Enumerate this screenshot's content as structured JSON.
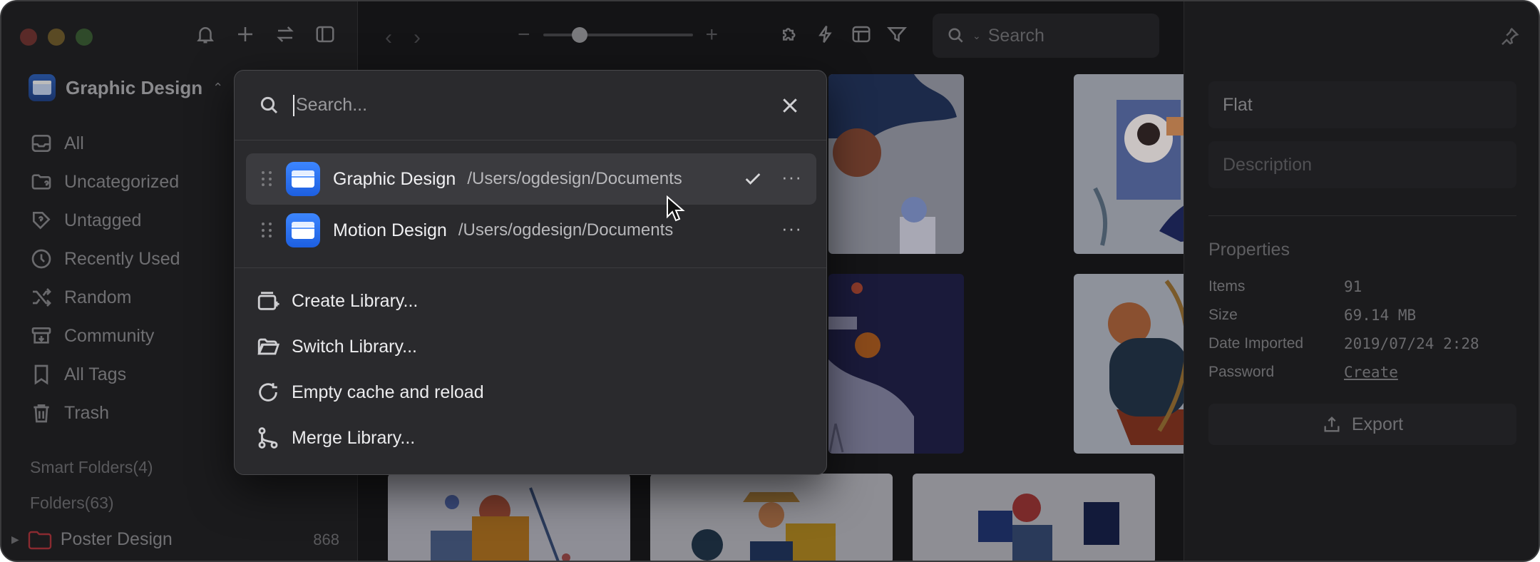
{
  "sidebar": {
    "library_name": "Graphic Design",
    "nav": [
      {
        "label": "All",
        "icon": "inbox-icon"
      },
      {
        "label": "Uncategorized",
        "icon": "folder-question-icon"
      },
      {
        "label": "Untagged",
        "icon": "tag-question-icon"
      },
      {
        "label": "Recently Used",
        "icon": "clock-icon"
      },
      {
        "label": "Random",
        "icon": "shuffle-icon"
      },
      {
        "label": "Community",
        "icon": "archive-icon"
      },
      {
        "label": "All Tags",
        "icon": "bookmark-icon"
      },
      {
        "label": "Trash",
        "icon": "trash-icon"
      }
    ],
    "smart_folders_label": "Smart Folders(4)",
    "folders_label": "Folders(63)",
    "poster_folder": {
      "label": "Poster Design",
      "count": "868"
    }
  },
  "toolbar": {
    "search_placeholder": "Search"
  },
  "inspector": {
    "name_value": "Flat",
    "description_placeholder": "Description",
    "properties_title": "Properties",
    "properties": [
      {
        "key": "Items",
        "value": "91"
      },
      {
        "key": "Size",
        "value": "69.14 MB"
      },
      {
        "key": "Date Imported",
        "value": "2019/07/24 2:28"
      },
      {
        "key": "Password",
        "value": "Create"
      }
    ],
    "export_label": "Export"
  },
  "popover": {
    "search_placeholder": "Search...",
    "libraries": [
      {
        "name": "Graphic Design",
        "path": "/Users/ogdesign/Documents",
        "active": true
      },
      {
        "name": "Motion Design",
        "path": "/Users/ogdesign/Documents",
        "active": false
      }
    ],
    "more_label": "···",
    "actions": [
      {
        "label": "Create Library...",
        "icon": "create-library-icon"
      },
      {
        "label": "Switch Library...",
        "icon": "folder-open-icon"
      },
      {
        "label": "Empty cache and reload",
        "icon": "reload-icon"
      },
      {
        "label": "Merge Library...",
        "icon": "merge-icon"
      }
    ]
  },
  "colors": {
    "accent_blue": "#2f7bff",
    "window_bg": "#141416",
    "popover_bg": "#2a2a2d",
    "poster_folder_red": "#c0303a"
  }
}
